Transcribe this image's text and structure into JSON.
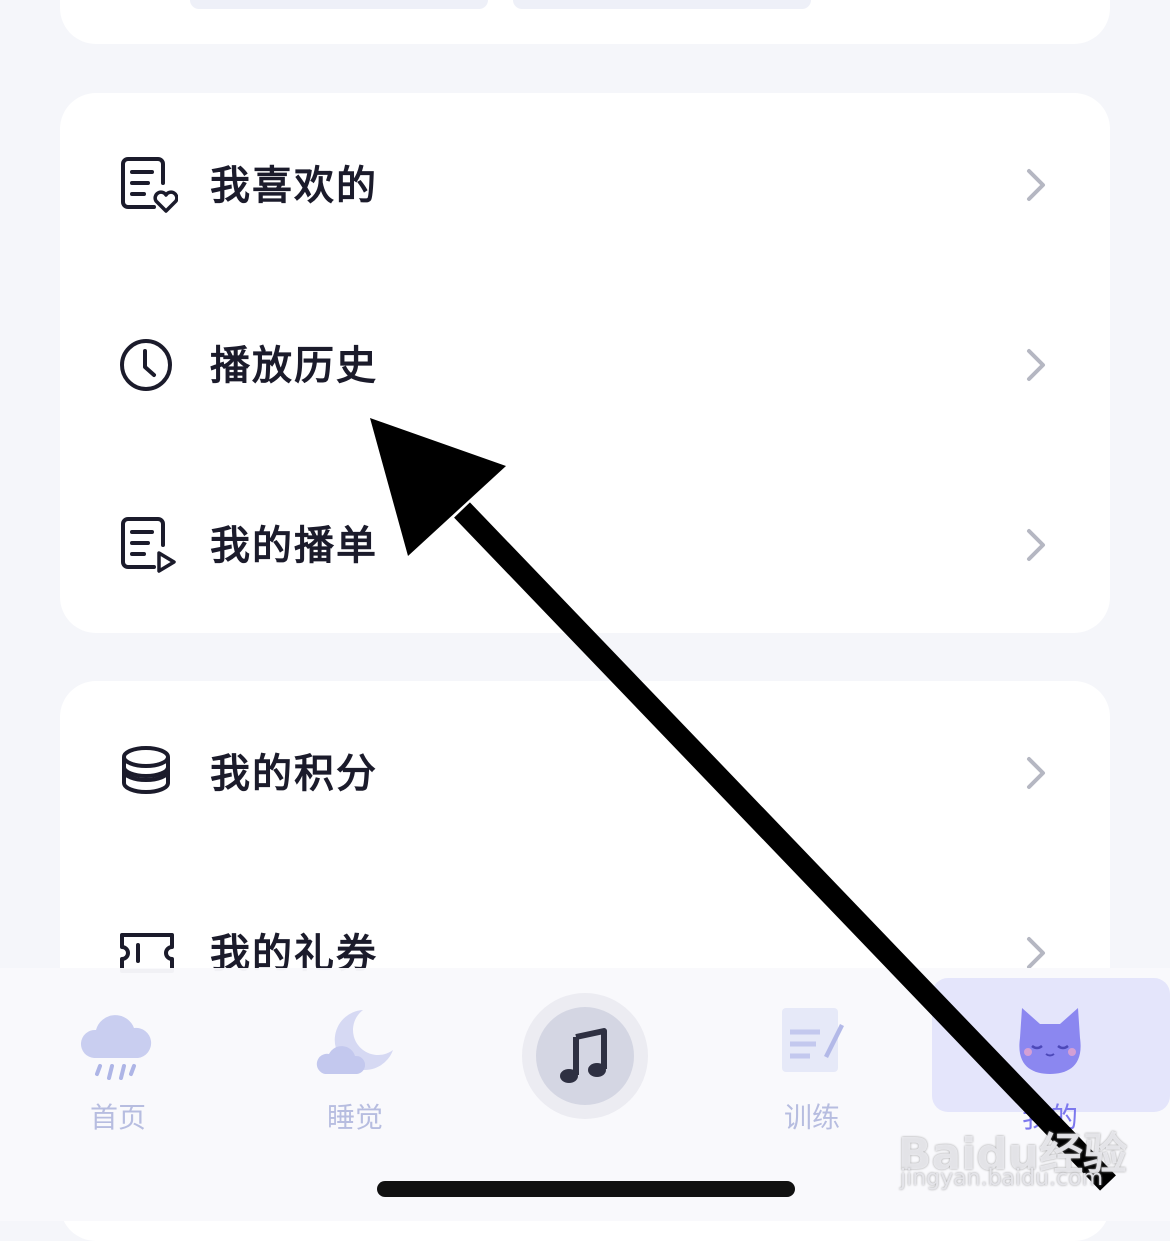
{
  "menu": {
    "favorites": "我喜欢的",
    "history": "播放历史",
    "playlist": "我的播单",
    "points": "我的积分",
    "coupons": "我的礼券"
  },
  "tabbar": {
    "home": "首页",
    "sleep": "睡觉",
    "training": "训练",
    "mine": "我的"
  },
  "watermark": {
    "brand": "Baidu经验",
    "url": "jingyan.baidu.com"
  }
}
